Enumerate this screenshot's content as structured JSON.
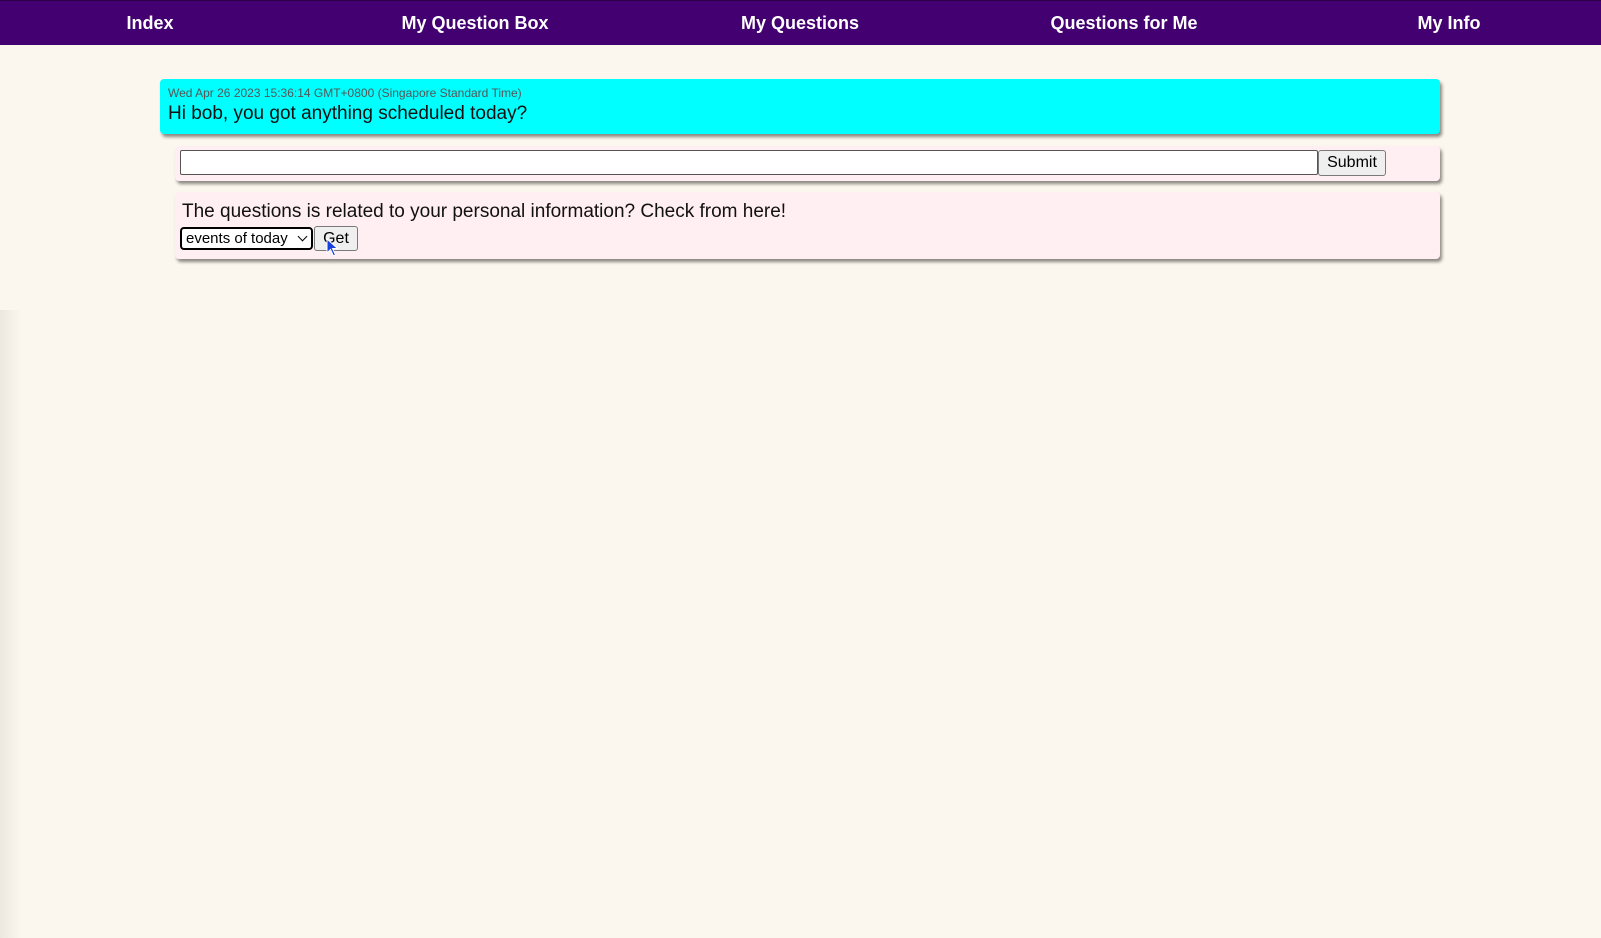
{
  "nav": {
    "items": [
      {
        "label": "Index"
      },
      {
        "label": "My Question Box"
      },
      {
        "label": "My Questions"
      },
      {
        "label": "Questions for Me"
      },
      {
        "label": "My Info"
      }
    ],
    "background": "#420070"
  },
  "question": {
    "timestamp": "Wed Apr 26 2023 15:36:14 GMT+0800 (Singapore Standard Time)",
    "text": "Hi bob, you got anything scheduled today?",
    "background": "#00ffff"
  },
  "reply": {
    "input_value": "",
    "submit_label": "Submit"
  },
  "info": {
    "prompt": "The questions is related to your personal information? Check from here!",
    "select_value": "events of today",
    "get_label": "Get",
    "background": "#ffeef2"
  },
  "icons": {
    "dropdown": "chevron-down-icon",
    "pointer": "cursor-arrow-icon"
  }
}
